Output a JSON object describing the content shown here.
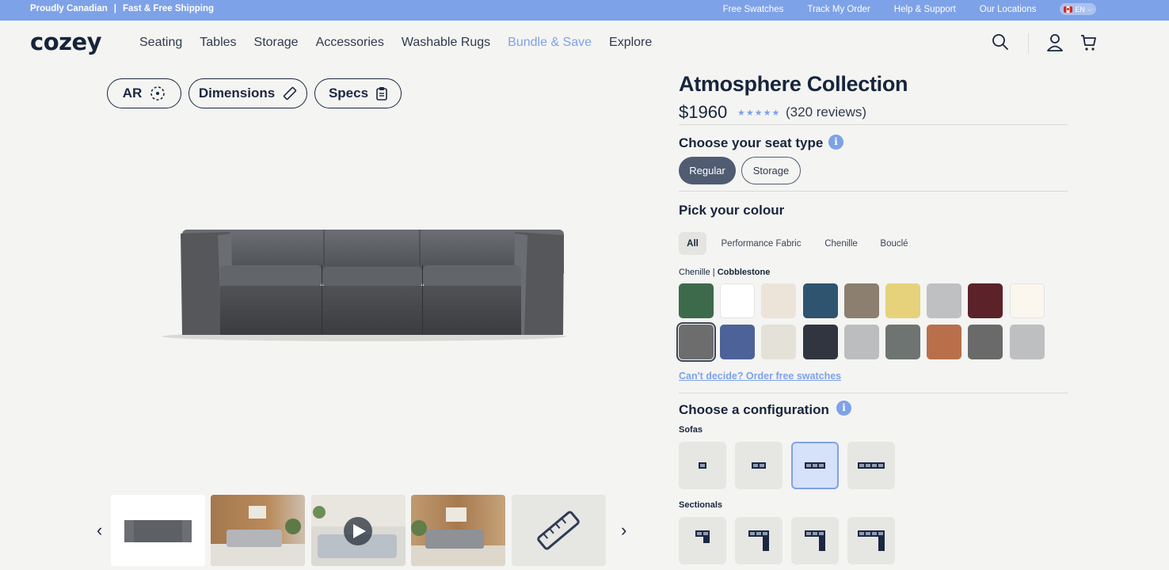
{
  "topbar": {
    "left_items": [
      "Proudly Canadian",
      "|",
      "Fast & Free Shipping"
    ],
    "links": [
      "Free Swatches",
      "Track My Order",
      "Help & Support",
      "Our Locations"
    ],
    "language": "EN"
  },
  "nav": {
    "logo": "cozey",
    "items": [
      "Seating",
      "Tables",
      "Storage",
      "Accessories",
      "Washable Rugs",
      "Bundle & Save",
      "Explore"
    ],
    "icons": [
      "search-icon",
      "account-icon",
      "cart-icon"
    ]
  },
  "media": {
    "buttons": [
      {
        "label": "AR",
        "icon": "ar-cube-icon"
      },
      {
        "label": "Dimensions",
        "icon": "ruler-icon"
      },
      {
        "label": "Specs",
        "icon": "clipboard-icon"
      }
    ],
    "thumbnails": [
      "sofa-product",
      "living-room-scene",
      "video-scene",
      "living-room-scene-2",
      "dimensions-ruler"
    ]
  },
  "product": {
    "title": "Atmosphere Collection",
    "price": "$1960",
    "rating_stars": "★★★★★",
    "reviews": "(320 reviews)",
    "seat": {
      "heading": "Choose your seat type",
      "options": [
        "Regular",
        "Storage"
      ],
      "selected": "Regular"
    },
    "colour": {
      "heading": "Pick your colour",
      "filters": [
        "All",
        "Performance Fabric",
        "Chenille",
        "Bouclé"
      ],
      "selected_filter": "All",
      "label_prefix": "Chenille | ",
      "label_name": "Cobblestone",
      "swatches_row1": [
        "#3e6a4c",
        "#ffffff",
        "#ece4d9",
        "#2e5470",
        "#8c7f70",
        "#e6d27a",
        "#bec0c2",
        "#5b2229",
        "#fbf6ee"
      ],
      "swatches_row2": [
        "#6d6d6d",
        "#4d6298",
        "#e4e1d8",
        "#30353f",
        "#bcbdbf",
        "#6d7471",
        "#b9704a",
        "#6a6a6a",
        "#bdbfc1"
      ],
      "selected_swatch": 9,
      "free_swatch_link": "Can't decide? Order free swatches"
    },
    "config": {
      "heading": "Choose a configuration",
      "sofas_label": "Sofas",
      "sectionals_label": "Sectionals",
      "sofa_seats": [
        1,
        2,
        3,
        4
      ],
      "selected_sofa_seats": 3,
      "sectional_seats": [
        2,
        3,
        3,
        4
      ]
    }
  }
}
